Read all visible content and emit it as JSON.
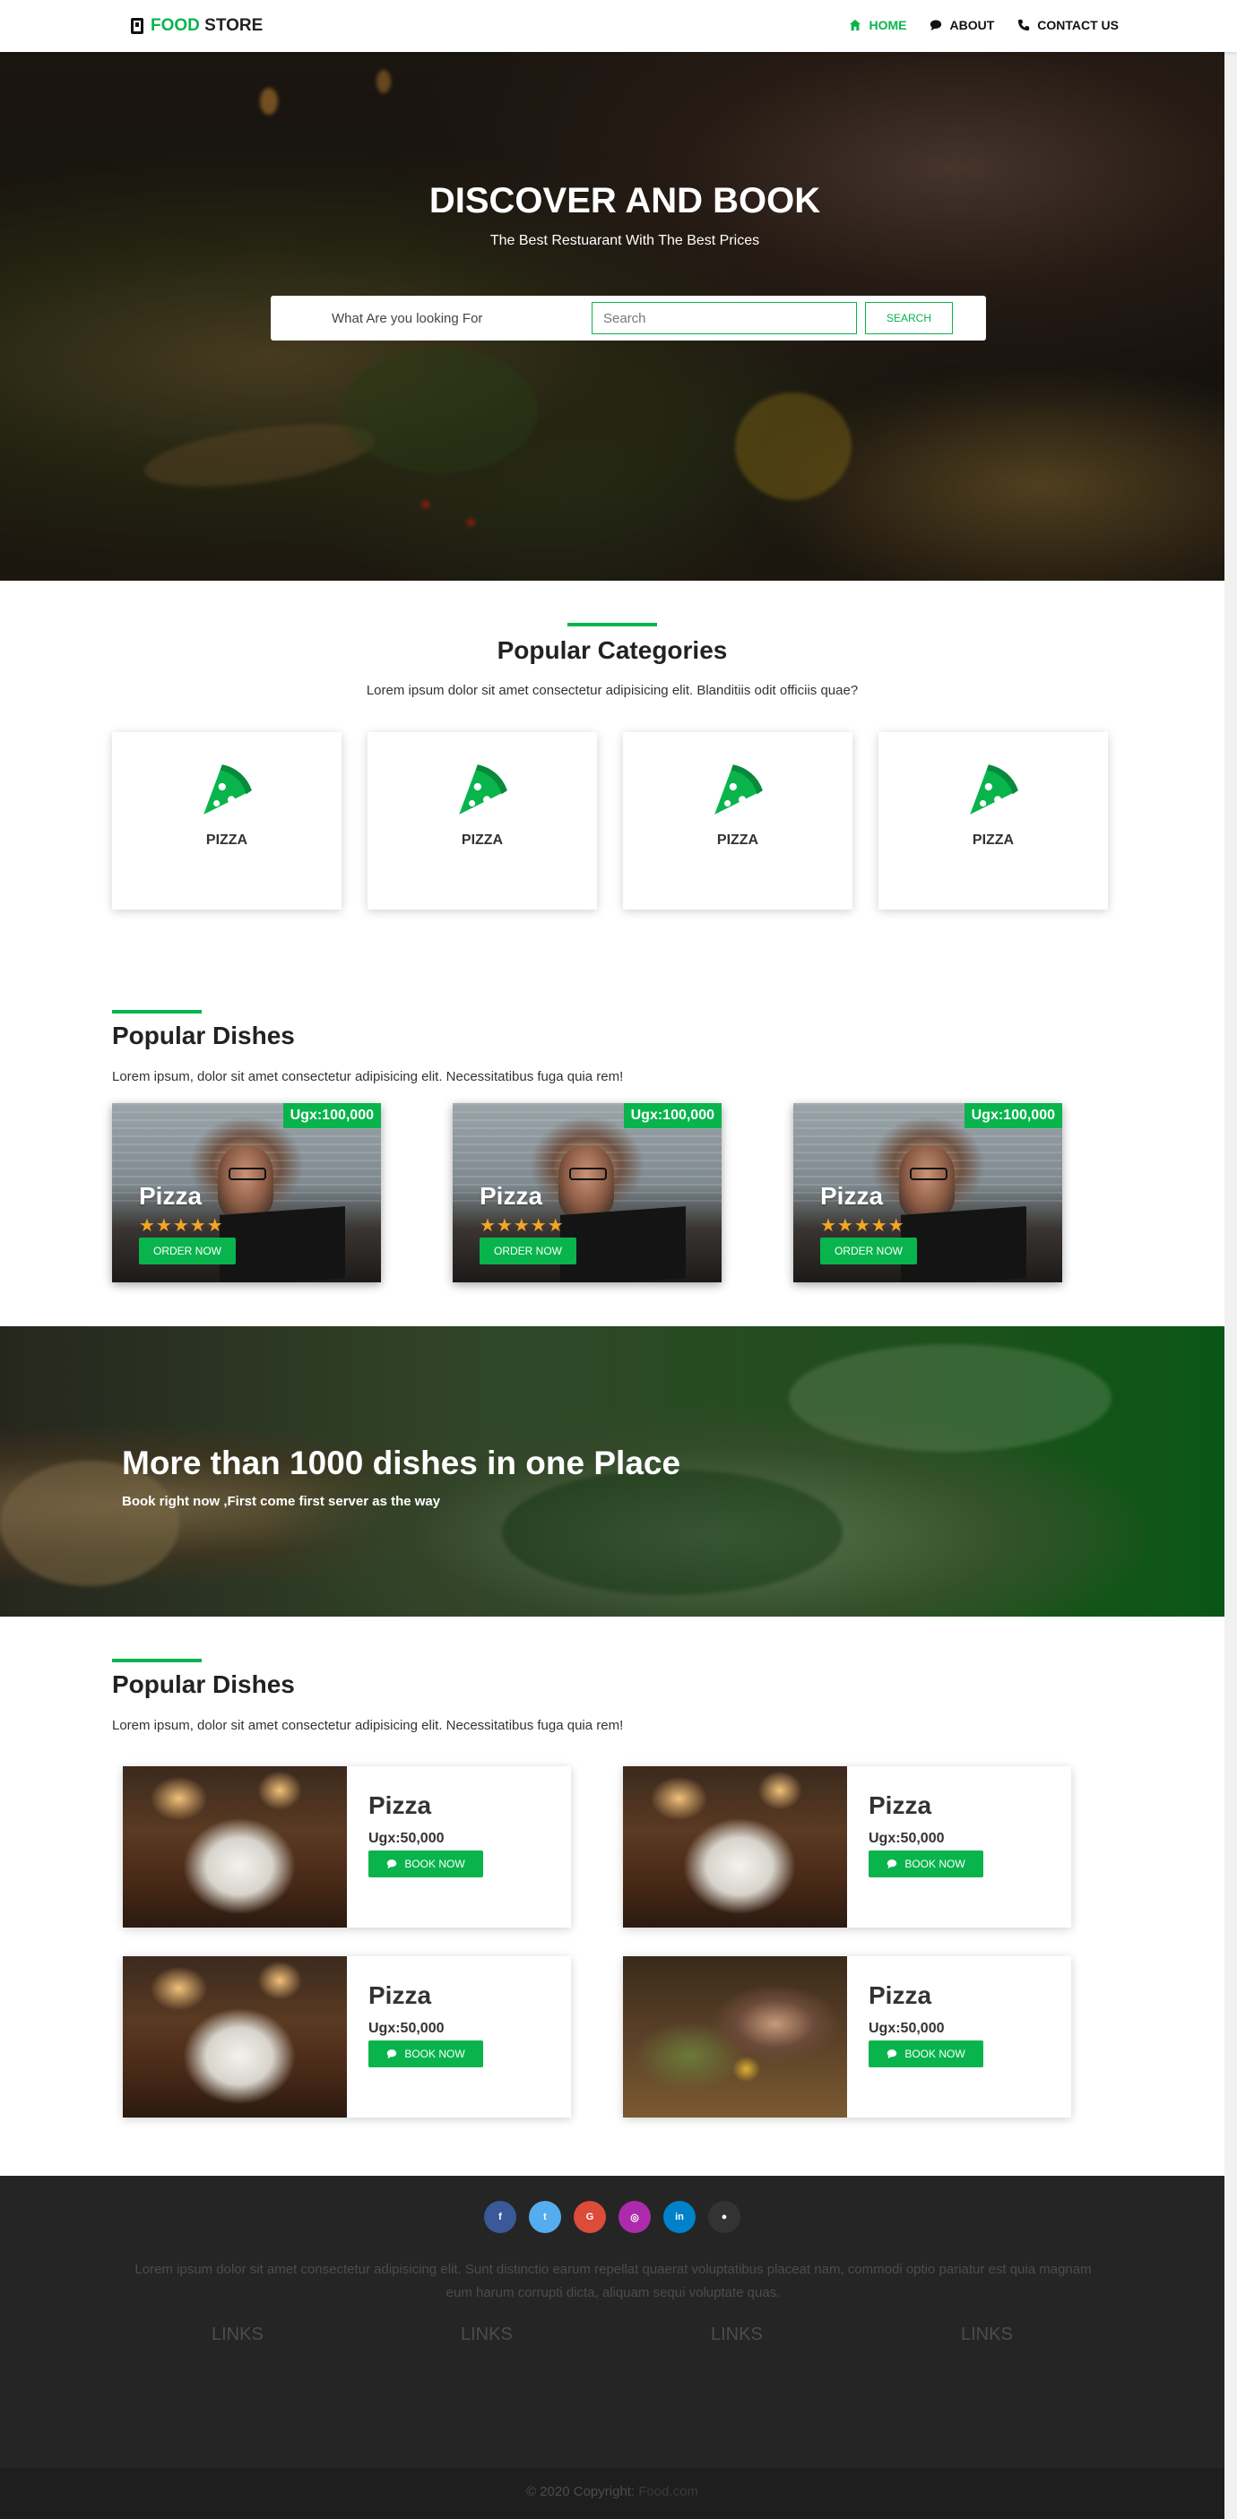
{
  "nav": {
    "logo_accent": "FOOD",
    "logo_rest": "STORE",
    "links": [
      {
        "label": "HOME",
        "icon": "home-icon"
      },
      {
        "label": "ABOUT",
        "icon": "chat-icon"
      },
      {
        "label": "CONTACT US",
        "icon": "phone-icon"
      }
    ]
  },
  "hero": {
    "title": "DISCOVER AND BOOK",
    "subtitle": "The Best Restuarant With The Best Prices",
    "search_label": "What Are you looking For",
    "search_placeholder": "Search",
    "search_button": "SEARCH"
  },
  "categories": {
    "title": "Popular Categories",
    "description": "Lorem ipsum dolor sit amet consectetur adipisicing elit. Blanditiis odit officiis quae?",
    "items": [
      {
        "label": "PIZZA",
        "icon": "pizza-icon"
      },
      {
        "label": "PIZZA",
        "icon": "pizza-icon"
      },
      {
        "label": "PIZZA",
        "icon": "pizza-icon"
      },
      {
        "label": "PIZZA",
        "icon": "pizza-icon"
      }
    ]
  },
  "popular_dishes": {
    "title": "Popular Dishes",
    "description": "Lorem ipsum, dolor sit amet consectetur adipisicing elit. Necessitatibus fuga quia rem!",
    "items": [
      {
        "name": "Pizza",
        "price": "Ugx:100,000",
        "rating": 5,
        "button": "ORDER NOW"
      },
      {
        "name": "Pizza",
        "price": "Ugx:100,000",
        "rating": 5,
        "button": "ORDER NOW"
      },
      {
        "name": "Pizza",
        "price": "Ugx:100,000",
        "rating": 5,
        "button": "ORDER NOW"
      }
    ]
  },
  "banner": {
    "title": "More than 1000 dishes in one Place",
    "subtitle": "Book right now ,First come first server as the way"
  },
  "popular_dishes_2": {
    "title": "Popular Dishes",
    "description": "Lorem ipsum, dolor sit amet consectetur adipisicing elit. Necessitatibus fuga quia rem!",
    "items": [
      {
        "name": "Pizza",
        "price": "Ugx:50,000",
        "button": "BOOK NOW"
      },
      {
        "name": "Pizza",
        "price": "Ugx:50,000",
        "button": "BOOK NOW"
      },
      {
        "name": "Pizza",
        "price": "Ugx:50,000",
        "button": "BOOK NOW"
      },
      {
        "name": "Pizza",
        "price": "Ugx:50,000",
        "button": "BOOK NOW"
      }
    ]
  },
  "footer": {
    "socials": [
      {
        "icon": "facebook-icon",
        "glyph": "f",
        "color": "#3b5998"
      },
      {
        "icon": "twitter-icon",
        "glyph": "t",
        "color": "#55acee"
      },
      {
        "icon": "google-icon",
        "glyph": "G",
        "color": "#dd4b39"
      },
      {
        "icon": "instagram-icon",
        "glyph": "◎",
        "color": "#ac2bac"
      },
      {
        "icon": "linkedin-icon",
        "glyph": "in",
        "color": "#0082ca"
      },
      {
        "icon": "github-icon",
        "glyph": "●",
        "color": "#333333"
      }
    ],
    "text": "Lorem ipsum dolor sit amet consectetur adipisicing elit. Sunt distinctio earum repellat quaerat voluptatibus placeat nam, commodi optio pariatur est quia magnam eum harum corrupti dicta, aliquam sequi voluptate quas.",
    "links": [
      "LINKS",
      "LINKS",
      "LINKS",
      "LINKS"
    ],
    "copyright": "© 2020 Copyright:",
    "copyright_brand": "Food.com"
  },
  "colors": {
    "accent": "#09b44d",
    "footer_bg": "#252525",
    "star": "#f5a623"
  }
}
